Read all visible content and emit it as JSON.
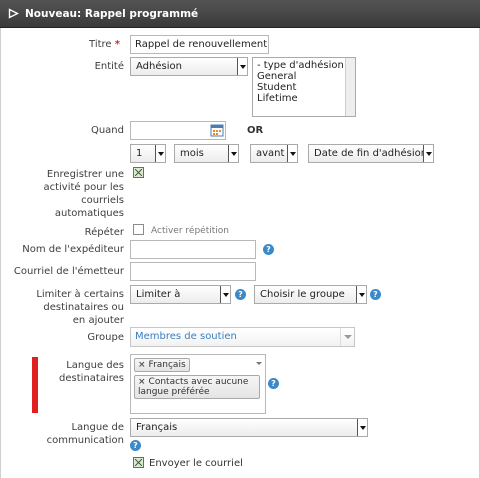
{
  "dialog": {
    "title": "Nouveau: Rappel programmé"
  },
  "form": {
    "titre": {
      "label": "Titre",
      "required_mark": "*",
      "value": "Rappel de renouvellement"
    },
    "entite": {
      "label": "Entité",
      "selected": "Adhésion",
      "options": [
        "- type d'adhésion -",
        "General",
        "Student",
        "Lifetime"
      ]
    },
    "quand": {
      "label": "Quand",
      "date_value": "",
      "or_label": "OR",
      "number": "1",
      "unit": "mois",
      "relation": "avant",
      "anchor": "Date de fin d'adhésion"
    },
    "enregistrer": {
      "label": "Enregistrer une activité pour les courriels automatiques",
      "checked": true
    },
    "repeter": {
      "label": "Répéter",
      "checkbox_label": "Activer répétition",
      "checked": false
    },
    "nom_expediteur": {
      "label": "Nom de l'expéditeur",
      "value": ""
    },
    "courriel_emetteur": {
      "label": "Courriel de l'émetteur",
      "value": ""
    },
    "limiter": {
      "label": "Limiter à certains destinataires ou en ajouter",
      "mode": "Limiter à",
      "group_select": "Choisir le groupe"
    },
    "groupe": {
      "label": "Groupe",
      "value": "Membres de soutien"
    },
    "langue_destinataires": {
      "label": "Langue des destinataires",
      "tags": [
        "Français",
        "Contacts avec aucune langue préférée"
      ]
    },
    "langue_communication": {
      "label": "Langue de communication",
      "value": "Français"
    },
    "envoyer": {
      "label": "Envoyer le courriel",
      "checked": true
    }
  },
  "help_icon_glyph": "?",
  "tag_remove_glyph": "×",
  "colors": {
    "titlebar": "#454545",
    "help": "#3b89c9",
    "required": "#c92d2d",
    "marker": "#e02020",
    "group_text": "#3a7fc1"
  }
}
